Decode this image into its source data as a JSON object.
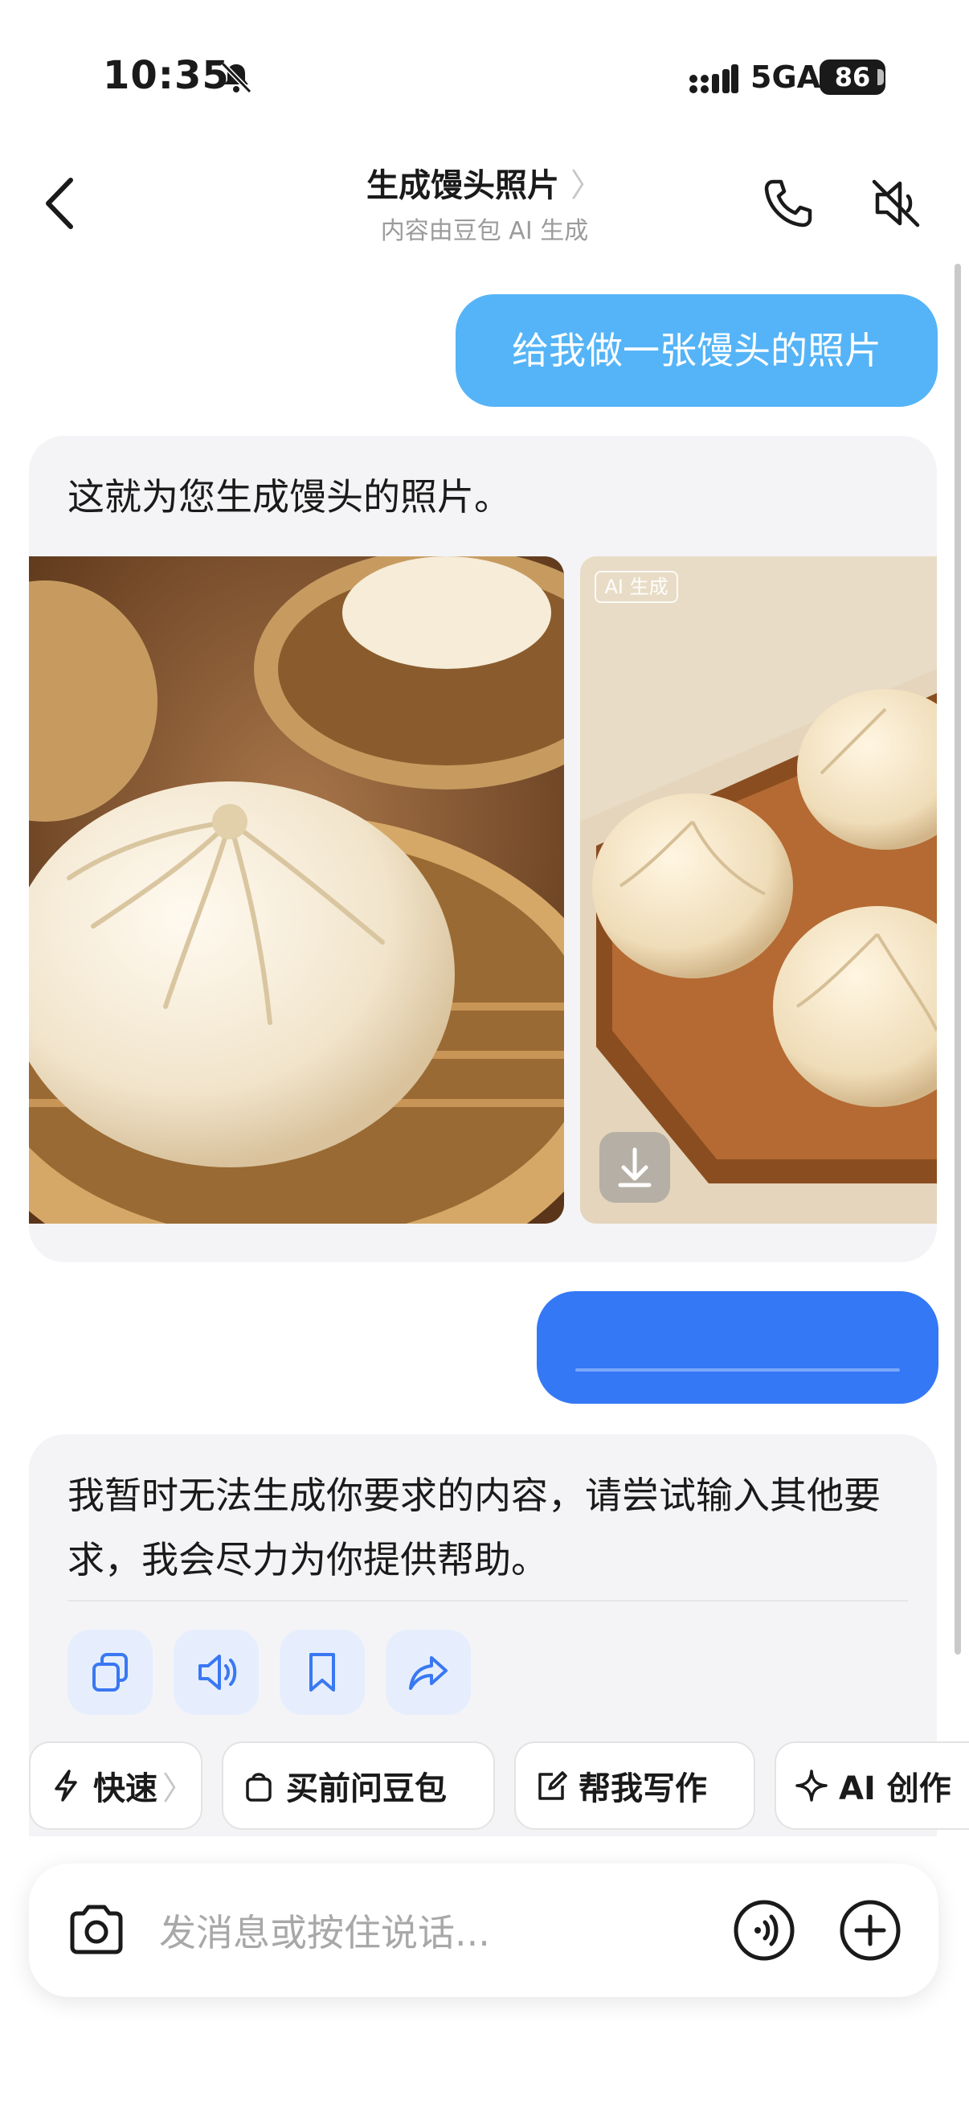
{
  "status_bar": {
    "time": "10:35",
    "network": "5GA",
    "battery": "86"
  },
  "header": {
    "title": "生成馒头照片",
    "title_chevron": "〉",
    "subtitle": "内容由豆包 AI 生成"
  },
  "messages": {
    "user1": "给我做一张馒头的照片",
    "bot1": "这就为您生成馒头的照片。",
    "ai_badge": "AI 生成",
    "bot2": "我暂时无法生成你要求的内容，请尝试输入其他要求，我会尽力为你提供帮助。"
  },
  "chips": {
    "fast": "快速",
    "fast_chevron": "〉",
    "shop": "买前问豆包",
    "write": "帮我写作",
    "create": "AI 创作"
  },
  "input": {
    "placeholder": "发消息或按住说话..."
  },
  "colors": {
    "user_bubble_light": "#55b4f7",
    "user_bubble_dark": "#3478f6",
    "action_icon": "#3a78f2"
  }
}
